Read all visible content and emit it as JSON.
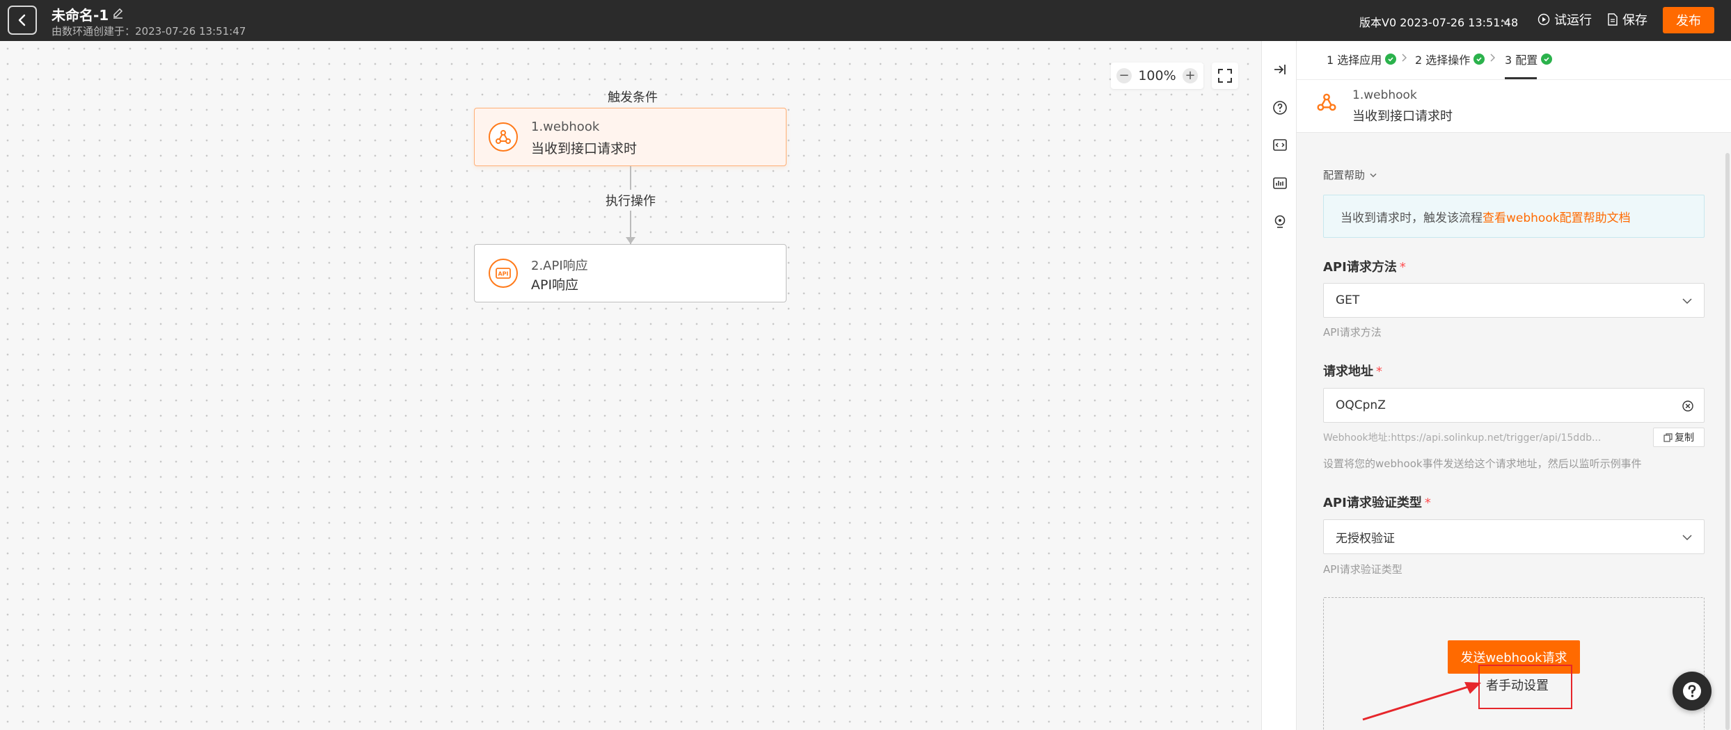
{
  "header": {
    "title": "未命名-1",
    "subtitle": "由数环通创建于：2023-07-26 13:51:47",
    "version": "版本V0 2023-07-26 13:51:48",
    "trial_run": "试运行",
    "save": "保存",
    "publish": "发布"
  },
  "canvas": {
    "zoom": "100%",
    "trigger_section_label": "触发条件",
    "action_section_label": "执行操作",
    "nodes": [
      {
        "title": "1.webhook",
        "subtitle": "当收到接口请求时"
      },
      {
        "title": "2.API响应",
        "subtitle": "API响应"
      }
    ]
  },
  "panel": {
    "steps": [
      {
        "label": "1 选择应用",
        "done": true
      },
      {
        "label": "2 选择操作",
        "done": true
      },
      {
        "label": "3 配置",
        "done": true
      }
    ],
    "header": {
      "title": "1.webhook",
      "subtitle": "当收到接口请求时"
    },
    "config_help": "配置帮助",
    "info_text": "当收到请求时，触发该流程",
    "info_link": "查看webhook配置帮助文档",
    "method_label": "API请求方法",
    "method_value": "GET",
    "method_hint": "API请求方法",
    "url_label": "请求地址",
    "url_value": "OQCpnZ",
    "webhook_url": "Webhook地址:https://api.solinkup.net/trigger/api/15ddb...",
    "copy": "复制",
    "url_hint": "设置将您的webhook事件发送给这个请求地址，然后以监听示例事件",
    "auth_label": "API请求验证类型",
    "auth_value": "无授权验证",
    "auth_hint": "API请求验证类型",
    "send_button": "发送webhook请求",
    "manual_text": "者手动设置"
  },
  "colors": {
    "accent": "#ff6a00",
    "topbar": "#2b2b2b",
    "success": "#2bb24c",
    "highlight": "#e6262b"
  }
}
